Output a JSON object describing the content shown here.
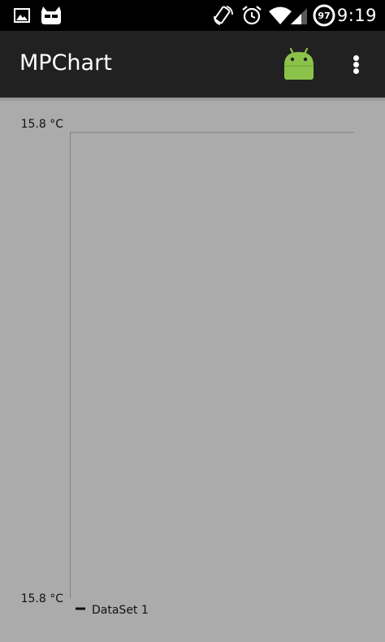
{
  "status_bar": {
    "time": "9:19",
    "battery_level": "97",
    "icons": [
      "image-icon",
      "cyanogen-icon",
      "rotate-icon",
      "alarm-icon",
      "wifi-icon",
      "signal-icon",
      "battery-icon"
    ]
  },
  "action_bar": {
    "title": "MPChart",
    "app_icon": "android-icon",
    "menu_icon": "overflow-menu-icon"
  },
  "colors": {
    "status_bar_bg": "#000000",
    "action_bar_bg": "#212121",
    "chart_bg": "#ababab",
    "android_green": "#8bc34a",
    "axis_line": "#7f7f7f",
    "text": "#111111"
  },
  "chart_data": {
    "type": "line",
    "title": "",
    "xlabel": "",
    "ylabel": "",
    "y_tick_labels": [
      "15.8 °C",
      "15.8 °C"
    ],
    "ylim": [
      15.8,
      15.8
    ],
    "grid": false,
    "legend_position": "bottom-left",
    "series": [
      {
        "name": "DataSet 1",
        "values": []
      }
    ]
  }
}
